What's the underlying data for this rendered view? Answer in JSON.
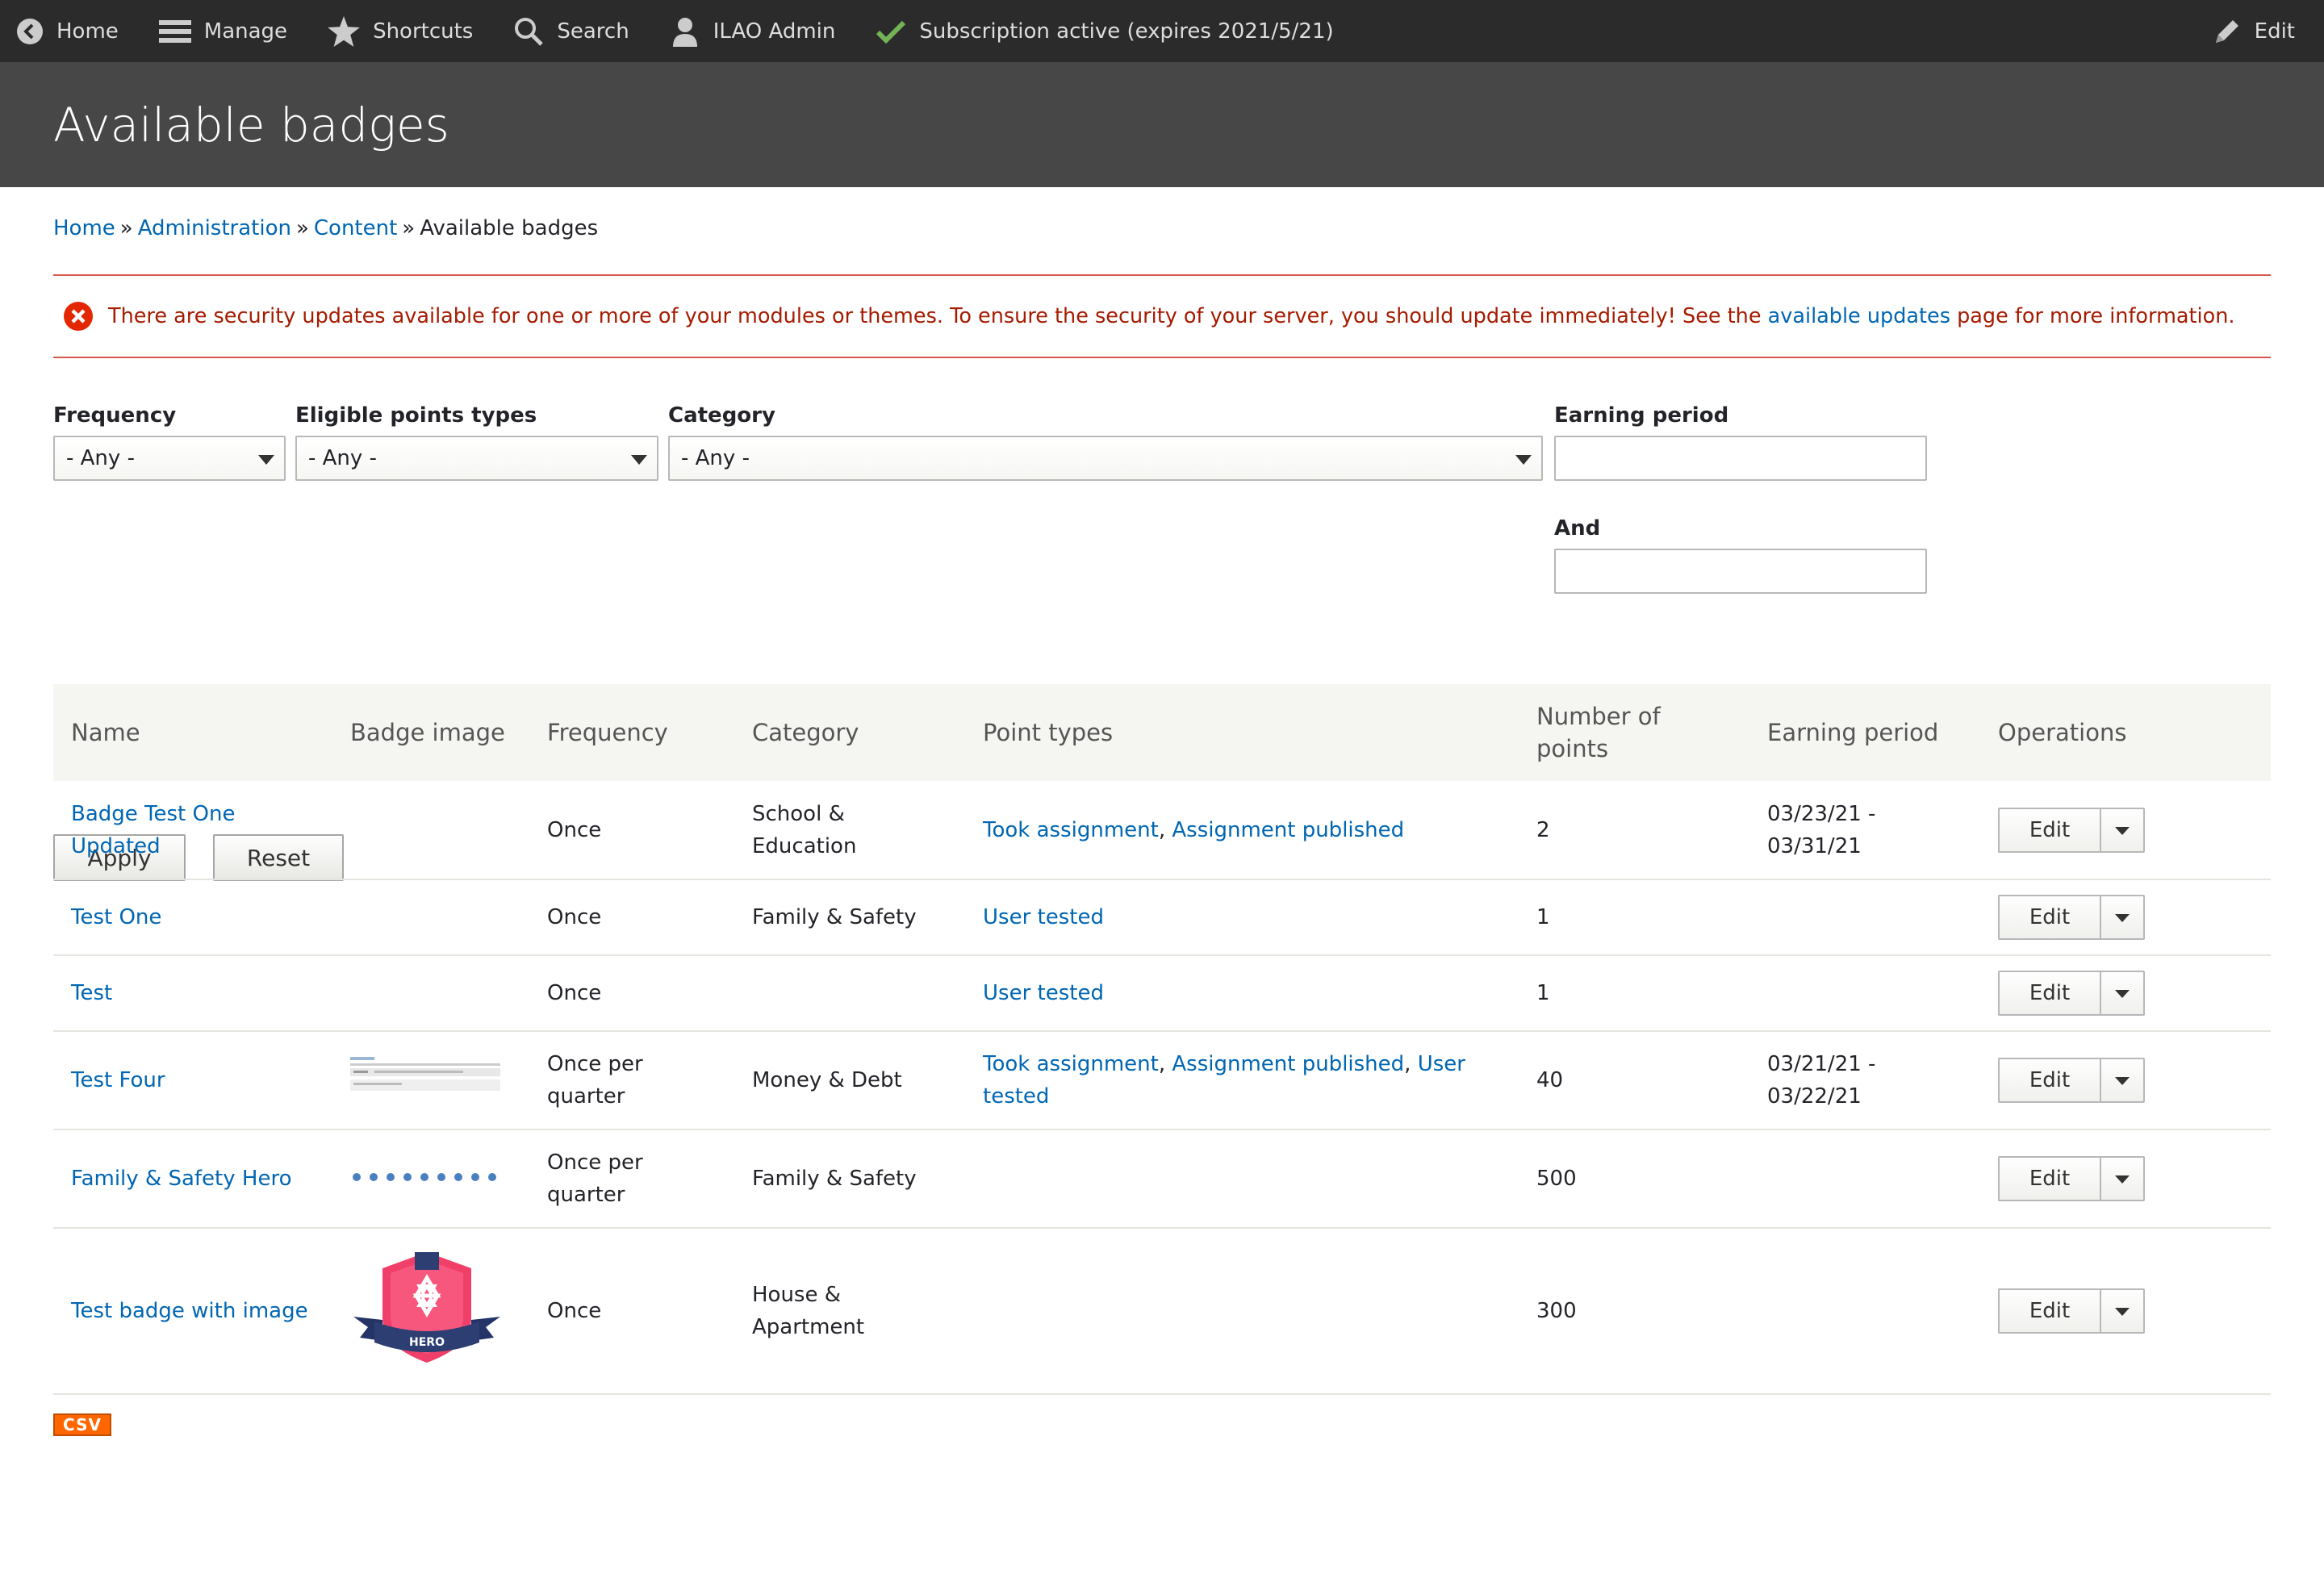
{
  "toolbar": {
    "home": "Home",
    "manage": "Manage",
    "shortcuts": "Shortcuts",
    "search": "Search",
    "user": "ILAO Admin",
    "subscription": "Subscription active (expires 2021/5/21)",
    "edit": "Edit"
  },
  "page": {
    "title": "Available badges"
  },
  "breadcrumb": {
    "home": "Home",
    "administration": "Administration",
    "content": "Content",
    "current": "Available badges",
    "separator": "»"
  },
  "message": {
    "text_before": "There are security updates available for one or more of your modules or themes. To ensure the security of your server, you should update immediately! See the ",
    "link": "available updates",
    "text_after": " page for more information."
  },
  "filters": {
    "frequency_label": "Frequency",
    "frequency_value": "- Any -",
    "points_label": "Eligible points types",
    "points_value": "- Any -",
    "category_label": "Category",
    "category_value": "- Any -",
    "earning_label": "Earning period",
    "and_label": "And",
    "apply": "Apply",
    "reset": "Reset"
  },
  "table": {
    "headers": {
      "name": "Name",
      "image": "Badge image",
      "frequency": "Frequency",
      "category": "Category",
      "point_types": "Point types",
      "points": "Number of points",
      "period": "Earning period",
      "ops": "Operations"
    },
    "edit_label": "Edit",
    "rows": [
      {
        "name": "Badge Test One Updated",
        "frequency": "Once",
        "category": "School & Education",
        "pt1": "Took assignment",
        "pt2": "Assignment published",
        "pt3": "",
        "points": "2",
        "period": "03/23/21 - 03/31/21"
      },
      {
        "name": "Test One",
        "frequency": "Once",
        "category": "Family & Safety",
        "pt1": "User tested",
        "pt2": "",
        "pt3": "",
        "points": "1",
        "period": ""
      },
      {
        "name": "Test",
        "frequency": "Once",
        "category": "",
        "pt1": "User tested",
        "pt2": "",
        "pt3": "",
        "points": "1",
        "period": ""
      },
      {
        "name": "Test Four",
        "frequency": "Once per quarter",
        "category": "Money & Debt",
        "pt1": "Took assignment",
        "pt2": "Assignment published",
        "pt3": "User tested",
        "points": "40",
        "period": "03/21/21 - 03/22/21"
      },
      {
        "name": "Family & Safety Hero",
        "frequency": "Once per quarter",
        "category": "Family & Safety",
        "pt1": "",
        "pt2": "",
        "pt3": "",
        "points": "500",
        "period": ""
      },
      {
        "name": "Test badge with image",
        "frequency": "Once",
        "category": "House & Apartment",
        "pt1": "",
        "pt2": "",
        "pt3": "",
        "points": "300",
        "period": "",
        "badge_text": "HERO"
      }
    ]
  },
  "csv_label": "CSV",
  "colors": {
    "link": "#0066b3",
    "error": "#a51b00",
    "toolbar": "#2b2b2b",
    "header": "#474747",
    "csv": "#ff6600"
  }
}
